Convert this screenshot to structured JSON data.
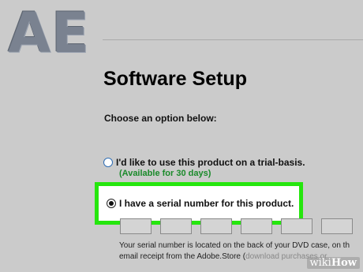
{
  "app": {
    "logo_text": "AE"
  },
  "setup": {
    "title": "Software Setup",
    "prompt": "Choose an option below:",
    "options": [
      {
        "label": "I'd like to use this product on a trial-basis.",
        "note": "(Available for 30 days)",
        "selected": false
      },
      {
        "label": "I have a serial number for this product.",
        "selected": true
      }
    ],
    "serial_fields": [
      "",
      "",
      "",
      "",
      "",
      ""
    ],
    "help": {
      "line1": "Your serial number is located on the back of your DVD case, on th",
      "line2_main": "email receipt from the Adobe.Store (",
      "line2_faded": "download purchases or"
    }
  },
  "colors": {
    "background": "#cbcbcb",
    "highlight": "#25e60d",
    "note_green": "#1a8a2a",
    "radio_blue": "#2f6db4"
  },
  "watermark": {
    "part1": "wiki",
    "part2": "How"
  }
}
